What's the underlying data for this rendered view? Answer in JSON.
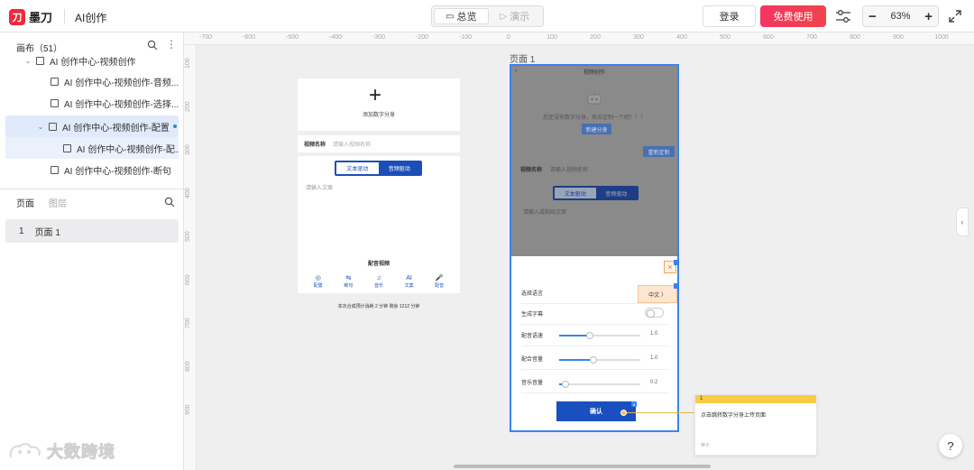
{
  "app": {
    "logo_text": "墨刀",
    "doc_title": "AI创作"
  },
  "toolbar": {
    "preview_label": "总览",
    "present_label": "演示",
    "login_label": "登录",
    "free_label": "免费使用",
    "zoom_level": "63%",
    "zoom_minus": "−",
    "zoom_plus": "+"
  },
  "left_panel": {
    "canvas_header": "画布（51）",
    "tree": [
      {
        "label": "AI 创作中心-视频创作",
        "level": 0
      },
      {
        "label": "AI 创作中心-视频创作-音频...",
        "level": 1
      },
      {
        "label": "AI 创作中心-视频创作-选择...",
        "level": 1
      },
      {
        "label": "AI 创作中心-视频创作-配置",
        "level": 1
      },
      {
        "label": "AI 创作中心-视频创作-配...",
        "level": 2
      },
      {
        "label": "AI 创作中心-视频创作-断句",
        "level": 1
      }
    ],
    "tab_pages": "页面",
    "tab_layers": "图层",
    "pages": [
      {
        "num": "1",
        "label": "页面 1"
      }
    ]
  },
  "ruler": {
    "top": [
      "-700",
      "-600",
      "-500",
      "-400",
      "-300",
      "-200",
      "-100",
      "0",
      "100",
      "200",
      "300",
      "400",
      "500",
      "600",
      "700",
      "800",
      "900",
      "1000"
    ],
    "left": [
      "100",
      "200",
      "300",
      "400",
      "500",
      "600",
      "700",
      "800",
      "900"
    ]
  },
  "canvas": {
    "page_label": "页面 1",
    "phone1": {
      "add_text": "添加数字分身",
      "name_label": "视频名称",
      "name_placeholder": "请输入视频名称",
      "seg_text": "文本驱动",
      "seg_audio": "音频驱动",
      "input_placeholder": "请输入文案",
      "section_title": "配音视频",
      "icons": [
        {
          "glyph": "◎",
          "label": "配置"
        },
        {
          "glyph": "⇆",
          "label": "断句"
        },
        {
          "glyph": "♫",
          "label": "音乐"
        },
        {
          "glyph": "AI",
          "label": "文案"
        },
        {
          "glyph": "🎤",
          "label": "配音"
        }
      ],
      "footer": "本次合成预计消耗 2 分钟  剩余 1212 分钟"
    },
    "phone2": {
      "header_title": "视频创作",
      "hint": "您还没有数字分身，快去定制一个吧！！！",
      "new_btn": "新建分身",
      "redefine_btn": "重新定制",
      "name_label": "视频名称",
      "name_placeholder": "请输入视频名称",
      "seg_text": "文本驱动",
      "seg_audio": "音频驱动",
      "input_placeholder": "请输入或粘贴文案",
      "settings": {
        "language_label": "选择语言",
        "language_value": "中文 〉",
        "subtitle_label": "生成字幕",
        "speed_label": "配音语速",
        "speed_value": "1.0",
        "voice_vol_label": "配合音量",
        "voice_vol_value": "1.0",
        "music_vol_label": "音乐音量",
        "music_vol_value": "0.2"
      },
      "confirm": "确认",
      "badge": "8"
    },
    "note": {
      "num": "1",
      "text": "点击跳转数字分身上传页面",
      "author": "帝子"
    }
  },
  "help": "?",
  "watermark": "大数跨境",
  "sliders": {
    "speed": 0.38,
    "voice_vol": 0.42,
    "music_vol": 0.08
  }
}
